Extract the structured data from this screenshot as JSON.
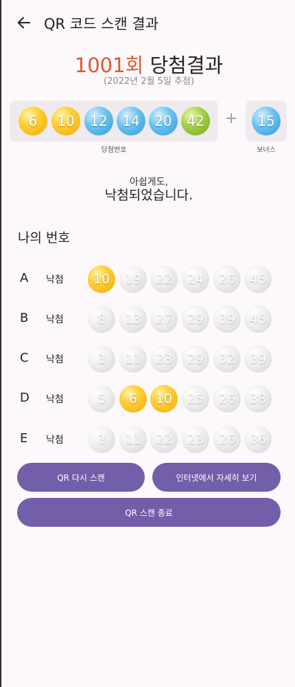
{
  "header": {
    "title": "QR 코드 스캔 결과"
  },
  "draw": {
    "round": "1001회",
    "round_label": "당첨결과",
    "date": "(2022년 2월 5일 추첨)",
    "winning_caption": "당첨번호",
    "bonus_caption": "보너스",
    "plus": "+",
    "winning_numbers": [
      {
        "value": "6",
        "color": "yellow"
      },
      {
        "value": "10",
        "color": "yellow"
      },
      {
        "value": "12",
        "color": "blue"
      },
      {
        "value": "14",
        "color": "blue"
      },
      {
        "value": "20",
        "color": "blue"
      },
      {
        "value": "42",
        "color": "green"
      }
    ],
    "bonus_number": {
      "value": "15",
      "color": "blue"
    }
  },
  "message": {
    "line1": "아쉽게도,",
    "line2": "낙첨되었습니다."
  },
  "my_numbers": {
    "title": "나의 번호",
    "rows": [
      {
        "letter": "A",
        "result": "낙첨",
        "numbers": [
          {
            "value": "10",
            "matched": true
          },
          {
            "value": "19",
            "matched": false
          },
          {
            "value": "22",
            "matched": false
          },
          {
            "value": "24",
            "matched": false
          },
          {
            "value": "26",
            "matched": false
          },
          {
            "value": "45",
            "matched": false
          }
        ]
      },
      {
        "letter": "B",
        "result": "낙첨",
        "numbers": [
          {
            "value": "8",
            "matched": false
          },
          {
            "value": "13",
            "matched": false
          },
          {
            "value": "27",
            "matched": false
          },
          {
            "value": "29",
            "matched": false
          },
          {
            "value": "39",
            "matched": false
          },
          {
            "value": "45",
            "matched": false
          }
        ]
      },
      {
        "letter": "C",
        "result": "낙첨",
        "numbers": [
          {
            "value": "3",
            "matched": false
          },
          {
            "value": "11",
            "matched": false
          },
          {
            "value": "23",
            "matched": false
          },
          {
            "value": "29",
            "matched": false
          },
          {
            "value": "32",
            "matched": false
          },
          {
            "value": "39",
            "matched": false
          }
        ]
      },
      {
        "letter": "D",
        "result": "낙첨",
        "numbers": [
          {
            "value": "5",
            "matched": false
          },
          {
            "value": "6",
            "matched": true
          },
          {
            "value": "10",
            "matched": true
          },
          {
            "value": "25",
            "matched": false
          },
          {
            "value": "26",
            "matched": false
          },
          {
            "value": "38",
            "matched": false
          }
        ]
      },
      {
        "letter": "E",
        "result": "낙첨",
        "numbers": [
          {
            "value": "3",
            "matched": false
          },
          {
            "value": "11",
            "matched": false
          },
          {
            "value": "22",
            "matched": false
          },
          {
            "value": "23",
            "matched": false
          },
          {
            "value": "26",
            "matched": false
          },
          {
            "value": "36",
            "matched": false
          }
        ]
      }
    ]
  },
  "buttons": {
    "rescan": "QR 다시 스캔",
    "details": "인터넷에서 자세히 보기",
    "exit": "QR 스캔 종료"
  },
  "colors": {
    "accent": "#735ea9",
    "round": "#e0582c",
    "background": "#fdf8fc"
  },
  "icons": {
    "back": "arrow-left-icon"
  }
}
